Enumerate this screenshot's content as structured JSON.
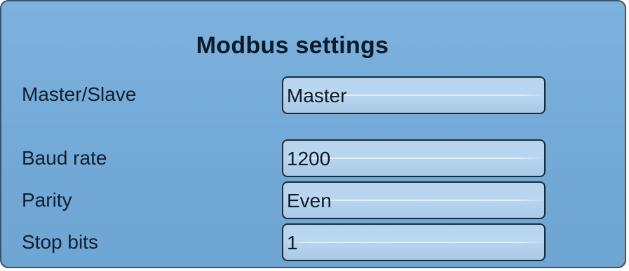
{
  "window": {
    "title": "Modbus settings"
  },
  "settings": [
    {
      "label": "Master/Slave",
      "value": "Master"
    },
    {
      "label": "Baud rate",
      "value": "1200"
    },
    {
      "label": "Parity",
      "value": "Even"
    },
    {
      "label": "Stop bits",
      "value": "1"
    }
  ],
  "colors": {
    "panel_background": "#74aad8",
    "field_background": "#b7d4ee",
    "border": "#1c2a36"
  }
}
